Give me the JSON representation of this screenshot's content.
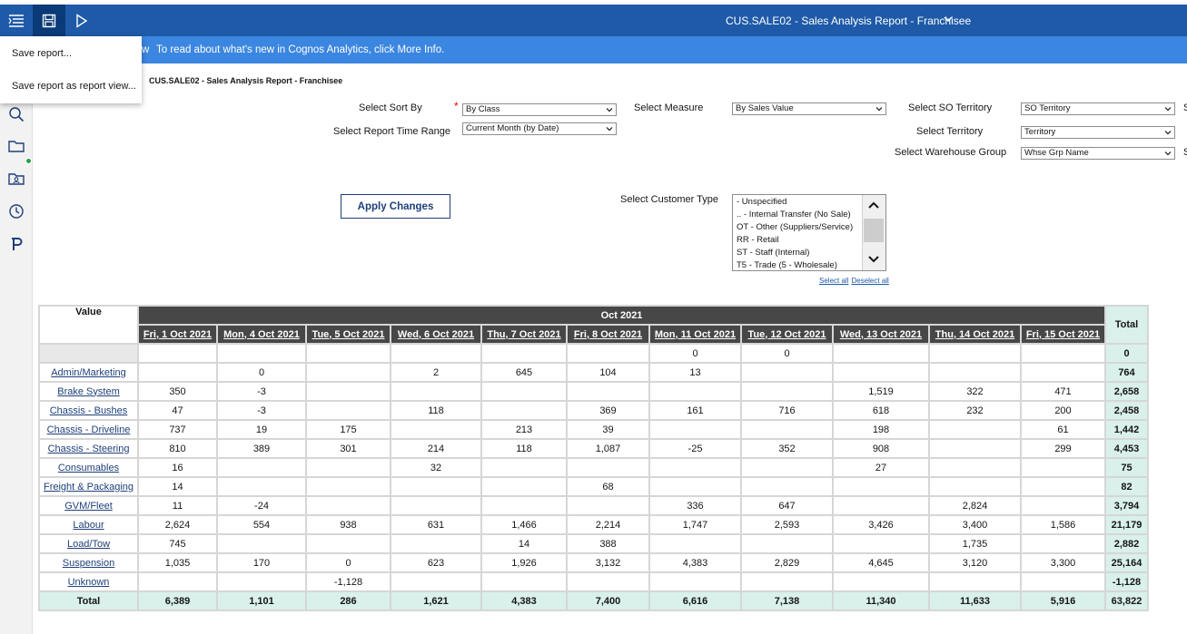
{
  "topbar": {
    "title": "CUS.SALE02 - Sales Analysis Report - Franchisee",
    "icons": [
      "navigation-menu-icon",
      "save-icon",
      "run-icon",
      "chevron-down-icon"
    ]
  },
  "banner": {
    "prefix": "w",
    "message": "To read about what's new in Cognos Analytics, click More Info."
  },
  "menu": {
    "items": [
      "Save report...",
      "Save report as report view..."
    ]
  },
  "sidebar": {
    "icons": [
      "search-icon",
      "folder-icon",
      "team-content-icon",
      "recent-icon",
      "p-icon"
    ]
  },
  "report_title": "CUS.SALE02 - Sales Analysis Report - Franchisee",
  "prompts": {
    "sort_by": {
      "label": "Select Sort By",
      "value": "By Class"
    },
    "time_range": {
      "label": "Select Report Time Range",
      "value": "Current Month (by Date)"
    },
    "measure": {
      "label": "Select Measure",
      "value": "By Sales Value"
    },
    "so_territory": {
      "label": "Select SO Territory",
      "value": "SO Territory"
    },
    "territory": {
      "label": "Select Territory",
      "value": "Territory"
    },
    "warehouse_group": {
      "label": "Select Warehouse Group",
      "value": "Whse Grp Name"
    },
    "cutoff_right": "S",
    "customer_type": {
      "label": "Select Customer Type",
      "options": [
        " - Unspecified",
        ".. - Internal Transfer (No Sale)",
        "OT - Other (Suppliers/Service)",
        "RR - Retail",
        "ST - Staff (Internal)",
        "T5 - Trade (5 - Wholesale)"
      ],
      "select_all": "Select all",
      "deselect_all": "Deselect all"
    },
    "apply_label": "Apply Changes"
  },
  "crosstab": {
    "value_label": "Value",
    "month": "Oct 2021",
    "total_label": "Total",
    "days": [
      "Fri, 1 Oct 2021",
      "Mon, 4 Oct 2021",
      "Tue, 5 Oct 2021",
      "Wed, 6 Oct 2021",
      "Thu, 7 Oct 2021",
      "Fri, 8 Oct 2021",
      "Mon, 11 Oct 2021",
      "Tue, 12 Oct 2021",
      "Wed, 13 Oct 2021",
      "Thu, 14 Oct 2021",
      "Fri, 15 Oct 2021"
    ],
    "rows": [
      {
        "label": "",
        "values": [
          "",
          "",
          "",
          "",
          "",
          "",
          "0",
          "0",
          "",
          "",
          ""
        ],
        "total": "0"
      },
      {
        "label": "Admin/Marketing",
        "values": [
          "",
          "0",
          "",
          "2",
          "645",
          "104",
          "13",
          "",
          "",
          "",
          ""
        ],
        "total": "764"
      },
      {
        "label": "Brake System",
        "values": [
          "350",
          "-3",
          "",
          "",
          "",
          "",
          "",
          "",
          "1,519",
          "322",
          "471"
        ],
        "total": "2,658"
      },
      {
        "label": "Chassis - Bushes",
        "values": [
          "47",
          "-3",
          "",
          "118",
          "",
          "369",
          "161",
          "716",
          "618",
          "232",
          "200"
        ],
        "total": "2,458"
      },
      {
        "label": "Chassis - Driveline",
        "values": [
          "737",
          "19",
          "175",
          "",
          "213",
          "39",
          "",
          "",
          "198",
          "",
          "61"
        ],
        "total": "1,442"
      },
      {
        "label": "Chassis - Steering",
        "values": [
          "810",
          "389",
          "301",
          "214",
          "118",
          "1,087",
          "-25",
          "352",
          "908",
          "",
          "299"
        ],
        "total": "4,453"
      },
      {
        "label": "Consumables",
        "values": [
          "16",
          "",
          "",
          "32",
          "",
          "",
          "",
          "",
          "27",
          "",
          ""
        ],
        "total": "75"
      },
      {
        "label": "Freight & Packaging",
        "values": [
          "14",
          "",
          "",
          "",
          "",
          "68",
          "",
          "",
          "",
          "",
          ""
        ],
        "total": "82"
      },
      {
        "label": "GVM/Fleet",
        "values": [
          "11",
          "-24",
          "",
          "",
          "",
          "",
          "336",
          "647",
          "",
          "2,824",
          ""
        ],
        "total": "3,794"
      },
      {
        "label": "Labour",
        "values": [
          "2,624",
          "554",
          "938",
          "631",
          "1,466",
          "2,214",
          "1,747",
          "2,593",
          "3,426",
          "3,400",
          "1,586"
        ],
        "total": "21,179"
      },
      {
        "label": "Load/Tow",
        "values": [
          "745",
          "",
          "",
          "",
          "14",
          "388",
          "",
          "",
          "",
          "1,735",
          ""
        ],
        "total": "2,882"
      },
      {
        "label": "Suspension",
        "values": [
          "1,035",
          "170",
          "0",
          "623",
          "1,926",
          "3,132",
          "4,383",
          "2,829",
          "4,645",
          "3,120",
          "3,300"
        ],
        "total": "25,164"
      },
      {
        "label": "Unknown",
        "values": [
          "",
          "",
          "-1,128",
          "",
          "",
          "",
          "",
          "",
          "",
          "",
          ""
        ],
        "total": "-1,128"
      }
    ],
    "totals": {
      "label": "Total",
      "values": [
        "6,389",
        "1,101",
        "286",
        "1,621",
        "4,383",
        "7,400",
        "6,616",
        "7,138",
        "11,340",
        "11,633",
        "5,916"
      ],
      "total": "63,822"
    }
  }
}
